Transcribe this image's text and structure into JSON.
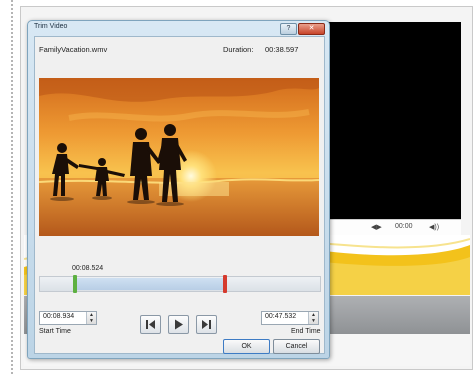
{
  "dialog": {
    "title": "Trim Video",
    "title_buttons": [
      "?",
      "✕"
    ]
  },
  "file": {
    "name": "FamilyVacation.wmv",
    "duration_label": "Duration:",
    "duration_value": "00:38.597"
  },
  "trim": {
    "current_time": "00:08.524",
    "start_time_value": "00:08.934",
    "end_time_value": "00:47.532",
    "start_time_label": "Start Time",
    "end_time_label": "End Time"
  },
  "buttons": {
    "ok": "OK",
    "cancel": "Cancel"
  },
  "background": {
    "player_time": "00:00"
  },
  "colors": {
    "start_handle": "#5db041",
    "end_handle": "#d53a2e"
  }
}
